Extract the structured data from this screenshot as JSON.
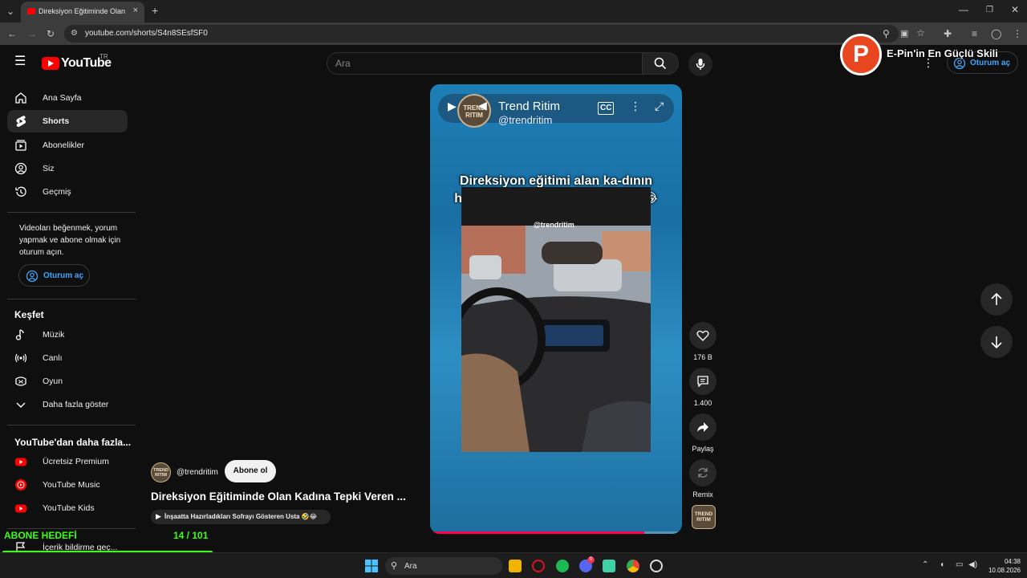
{
  "browser": {
    "tab_title": "Direksiyon Eğitiminde Olan Kadı",
    "tab_close": "×",
    "new_tab": "+",
    "url": "youtube.com/shorts/S4n8SEsfSF0"
  },
  "header": {
    "logo_text": "YouTube",
    "region": "TR",
    "search_placeholder": "Ara",
    "signin_label": "Oturum aç"
  },
  "sidebar": {
    "items": [
      {
        "label": "Ana Sayfa",
        "icon": "home-icon"
      },
      {
        "label": "Shorts",
        "icon": "shorts-icon",
        "active": true
      },
      {
        "label": "Abonelikler",
        "icon": "subscriptions-icon"
      },
      {
        "label": "Siz",
        "icon": "user-icon"
      },
      {
        "label": "Geçmiş",
        "icon": "history-icon"
      }
    ],
    "signin_message": "Videoları beğenmek, yorum yapmak ve abone olmak için oturum açın.",
    "signin_button": "Oturum aç",
    "explore_title": "Keşfet",
    "explore_items": [
      {
        "label": "Müzik",
        "icon": "music-icon"
      },
      {
        "label": "Canlı",
        "icon": "live-icon"
      },
      {
        "label": "Oyun",
        "icon": "gaming-icon"
      },
      {
        "label": "Daha fazla göster",
        "icon": "chevron-down-icon"
      }
    ],
    "more_title": "YouTube'dan daha fazla...",
    "more_items": [
      {
        "label": "Ücretsiz Premium",
        "icon": "youtube-premium-icon"
      },
      {
        "label": "YouTube Music",
        "icon": "youtube-music-icon"
      },
      {
        "label": "YouTube Kids",
        "icon": "youtube-kids-icon"
      },
      {
        "label": "İçerik bildirme geç...",
        "icon": "flag-icon"
      }
    ]
  },
  "video": {
    "channel_name": "Trend Ritim",
    "channel_handle": "@trendritim",
    "channel_avatar_text": "TREND RITIM",
    "caption": "Direksiyon eğitimi alan ka-dının hareketine tepki veren gençler 😂",
    "watermark": "@trendritim",
    "progress": 0.85,
    "title": "Direksiyon Eğitiminde Olan Kadına Tepki Veren ...",
    "subscribe_label": "Abone ol",
    "related_chip": "İnşaatta Hazırladıkları Sofrayı Gösteren Usta 🤣😂"
  },
  "actions": {
    "like_count": "176 B",
    "comment_count": "1.400",
    "share_label": "Paylaş",
    "remix_label": "Remix"
  },
  "overlay": {
    "goal_title": "ABONE HEDEFİ",
    "goal_count": "14 / 101",
    "goal_progress": 0.139,
    "brand_letter": "P",
    "brand_text": "E-Pin'in En Güçlü Skili"
  },
  "taskbar": {
    "search_label": "Ara",
    "time": "04:38",
    "date": "10.08.2026",
    "discord_badge": "9"
  },
  "colors": {
    "accent_red": "#ff0000",
    "link_blue": "#3ea6ff",
    "goal_green": "#39ff14",
    "brand_orange": "#e8461e"
  }
}
